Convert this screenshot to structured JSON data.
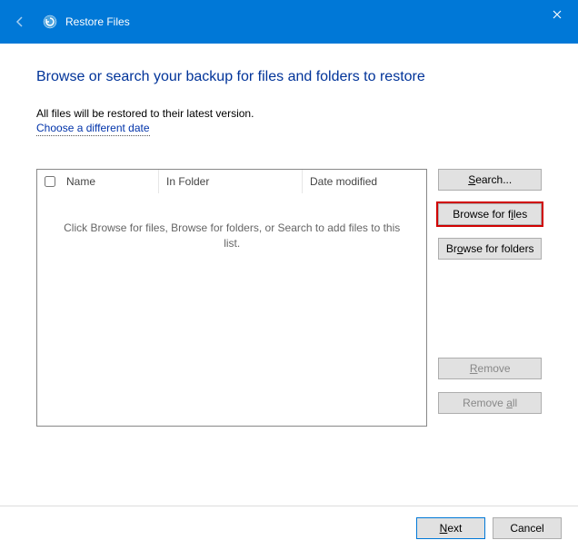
{
  "titlebar": {
    "title": "Restore Files"
  },
  "heading": "Browse or search your backup for files and folders to restore",
  "subtext": "All files will be restored to their latest version.",
  "link": "Choose a different date",
  "columns": {
    "name": "Name",
    "folder": "In Folder",
    "date": "Date modified"
  },
  "emptyText": "Click Browse for files, Browse for folders, or Search to add files to this list.",
  "buttons": {
    "search": "Search...",
    "browseFiles": "Browse for files",
    "browseFolders": "Browse for folders",
    "remove": "Remove",
    "removeAll": "Remove all",
    "next": "Next",
    "cancel": "Cancel"
  },
  "accel": {
    "search": "S",
    "files": "i",
    "folders": "o",
    "remove": "R",
    "removeAll": "a",
    "next": "N"
  }
}
